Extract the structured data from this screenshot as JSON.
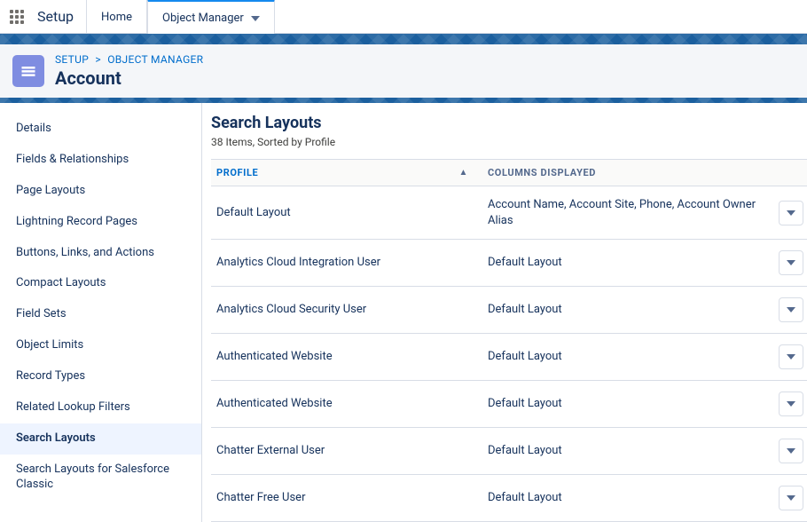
{
  "top": {
    "appTitle": "Setup",
    "tabs": [
      {
        "label": "Home",
        "active": false,
        "hasChevron": false
      },
      {
        "label": "Object Manager",
        "active": true,
        "hasChevron": true
      }
    ]
  },
  "header": {
    "breadcrumb": [
      "SETUP",
      "OBJECT MANAGER"
    ],
    "title": "Account"
  },
  "sidebar": {
    "items": [
      {
        "label": "Details",
        "active": false
      },
      {
        "label": "Fields & Relationships",
        "active": false
      },
      {
        "label": "Page Layouts",
        "active": false
      },
      {
        "label": "Lightning Record Pages",
        "active": false
      },
      {
        "label": "Buttons, Links, and Actions",
        "active": false
      },
      {
        "label": "Compact Layouts",
        "active": false
      },
      {
        "label": "Field Sets",
        "active": false
      },
      {
        "label": "Object Limits",
        "active": false
      },
      {
        "label": "Record Types",
        "active": false
      },
      {
        "label": "Related Lookup Filters",
        "active": false
      },
      {
        "label": "Search Layouts",
        "active": true
      },
      {
        "label": "Search Layouts for Salesforce Classic",
        "active": false
      }
    ]
  },
  "main": {
    "title": "Search Layouts",
    "subtitle": "38 Items, Sorted by Profile",
    "columns": {
      "profile": "PROFILE",
      "columnsDisplayed": "COLUMNS DISPLAYED"
    },
    "rows": [
      {
        "profile": "Default Layout",
        "columnsDisplayed": "Account Name, Account Site, Phone, Account Owner Alias"
      },
      {
        "profile": "Analytics Cloud Integration User",
        "columnsDisplayed": "Default Layout"
      },
      {
        "profile": "Analytics Cloud Security User",
        "columnsDisplayed": "Default Layout"
      },
      {
        "profile": "Authenticated Website",
        "columnsDisplayed": "Default Layout"
      },
      {
        "profile": "Authenticated Website",
        "columnsDisplayed": "Default Layout"
      },
      {
        "profile": "Chatter External User",
        "columnsDisplayed": "Default Layout"
      },
      {
        "profile": "Chatter Free User",
        "columnsDisplayed": "Default Layout"
      }
    ]
  }
}
